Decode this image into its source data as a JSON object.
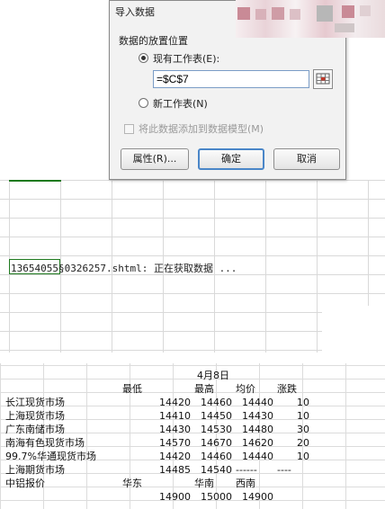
{
  "dialog": {
    "title": "导入数据",
    "group_label": "数据的放置位置",
    "existing_sheet_label": "现有工作表(E):",
    "reference_value": "=$C$7",
    "new_sheet_label": "新工作表(N)",
    "add_to_model_label": "将此数据添加到数据模型(M)",
    "properties_button": "属性(R)...",
    "ok_button": "确定",
    "cancel_button": "取消"
  },
  "sheet": {
    "loading_text": "13654055§0326257.shtml: 正在获取数据 ..."
  },
  "table": {
    "date": "4月8日",
    "headers": [
      "",
      "最低",
      "最高",
      "均价",
      "涨跌"
    ],
    "rows": [
      [
        "长江现货市场",
        "14420",
        "14460",
        "14440",
        "10"
      ],
      [
        "上海现货市场",
        "14410",
        "14450",
        "14430",
        "10"
      ],
      [
        "广东南储市场",
        "14430",
        "14530",
        "14480",
        "30"
      ],
      [
        "南海有色现货市场",
        "14570",
        "14670",
        "14620",
        "20"
      ],
      [
        "99.7%华通现货市场",
        "14420",
        "14460",
        "14440",
        "10"
      ],
      [
        "上海期货市场",
        "14485",
        "14540",
        "------",
        "----"
      ]
    ],
    "quote_header": [
      "中铝报价",
      "华东",
      "华南",
      "西南",
      ""
    ],
    "quote_values": [
      "",
      "14900",
      "15000",
      "14900",
      ""
    ]
  }
}
